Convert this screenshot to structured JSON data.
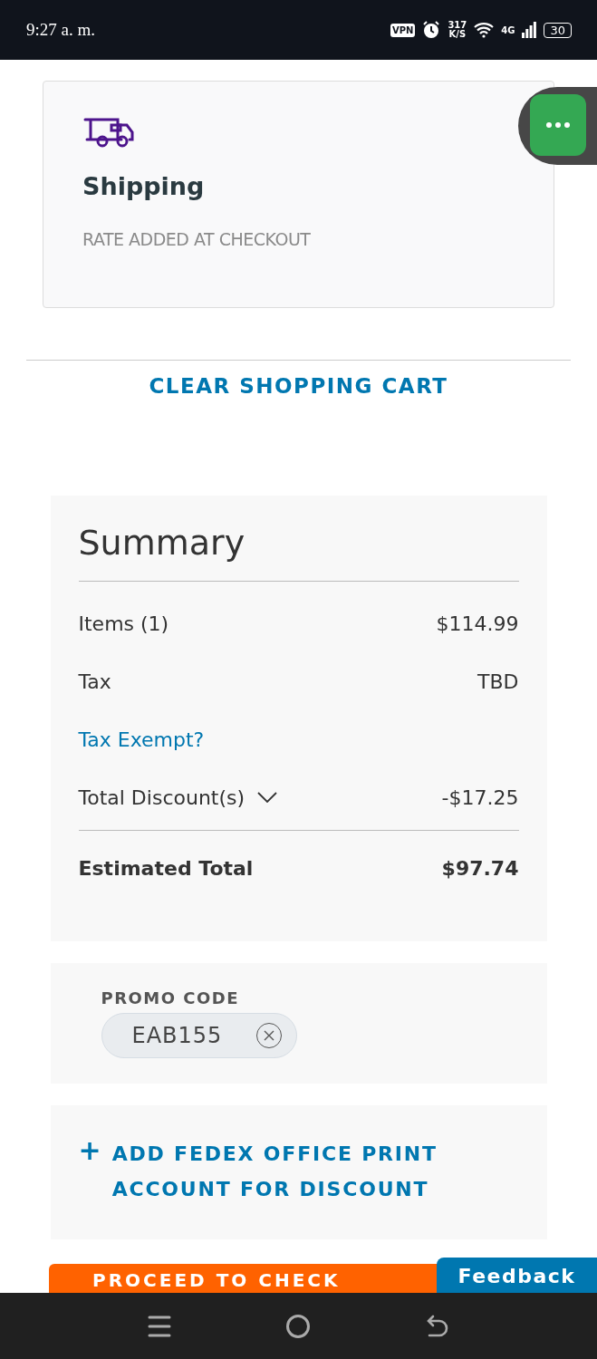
{
  "status_bar": {
    "time": "9:27 a. m.",
    "vpn": "VPN",
    "speed": "317",
    "speed_unit": "K/S",
    "network": "4G",
    "battery": "30"
  },
  "shipping": {
    "title": "Shipping",
    "note": "RATE ADDED AT CHECKOUT"
  },
  "clear_cart": "CLEAR SHOPPING CART",
  "summary": {
    "title": "Summary",
    "rows": [
      {
        "kind": "line",
        "label": "Items (1)",
        "value": "$114.99"
      },
      {
        "kind": "line",
        "label": "Tax",
        "value": "TBD"
      },
      {
        "kind": "link",
        "label": "Tax Exempt?"
      },
      {
        "kind": "toggle",
        "label": "Total Discount(s)",
        "value": "-$17.25",
        "expanded": false
      },
      {
        "kind": "total",
        "label": "Estimated Total",
        "value": "$97.74"
      }
    ]
  },
  "promo": {
    "label": "PROMO CODE",
    "code": "EAB155"
  },
  "add_account": {
    "plus": "+",
    "text": "ADD FEDEX OFFICE PRINT ACCOUNT FOR DISCOUNT"
  },
  "checkout_button": "PROCEED TO CHECK",
  "feedback": "Feedback"
}
